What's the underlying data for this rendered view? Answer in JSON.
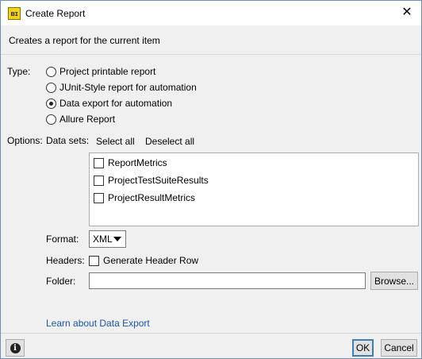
{
  "window": {
    "title": "Create Report",
    "app_icon_glyph": "ʙɪ",
    "close_glyph": "✕"
  },
  "subtitle": "Creates a report for the current item",
  "type_section": {
    "label": "Type:",
    "options": [
      {
        "label": "Project printable report",
        "selected": false
      },
      {
        "label": "JUnit-Style report for automation",
        "selected": false
      },
      {
        "label": "Data export for automation",
        "selected": true
      },
      {
        "label": "Allure Report",
        "selected": false
      }
    ]
  },
  "options_section": {
    "label": "Options:",
    "datasets_label": "Data sets:",
    "select_all": "Select all",
    "deselect_all": "Deselect all",
    "datasets": [
      {
        "label": "ReportMetrics",
        "checked": false
      },
      {
        "label": "ProjectTestSuiteResults",
        "checked": false
      },
      {
        "label": "ProjectResultMetrics",
        "checked": false
      }
    ]
  },
  "format": {
    "label": "Format:",
    "value": "XML"
  },
  "headers": {
    "label": "Headers:",
    "checkbox_label": "Generate Header Row",
    "checked": false
  },
  "folder": {
    "label": "Folder:",
    "value": "",
    "browse_label": "Browse..."
  },
  "learn_link": "Learn about Data Export",
  "footer": {
    "info_glyph": "i",
    "ok_label": "OK",
    "cancel_label": "Cancel"
  }
}
